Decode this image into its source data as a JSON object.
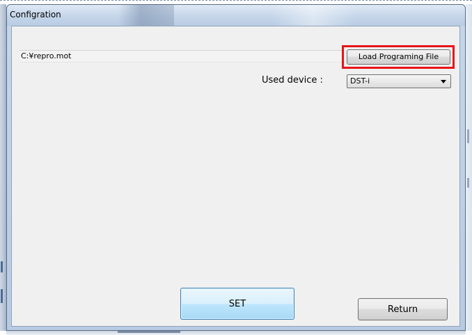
{
  "window": {
    "title": "Configration"
  },
  "file": {
    "path": "C:¥repro.mot",
    "load_button_label": "Load Programing File"
  },
  "device": {
    "label": "Used device :",
    "selected": "DST-i"
  },
  "actions": {
    "set_label": "SET",
    "return_label": "Return"
  },
  "colors": {
    "highlight_box": "#e8141a",
    "set_button_border": "#3c7fb1",
    "set_button_fill": "#bee6fd"
  }
}
